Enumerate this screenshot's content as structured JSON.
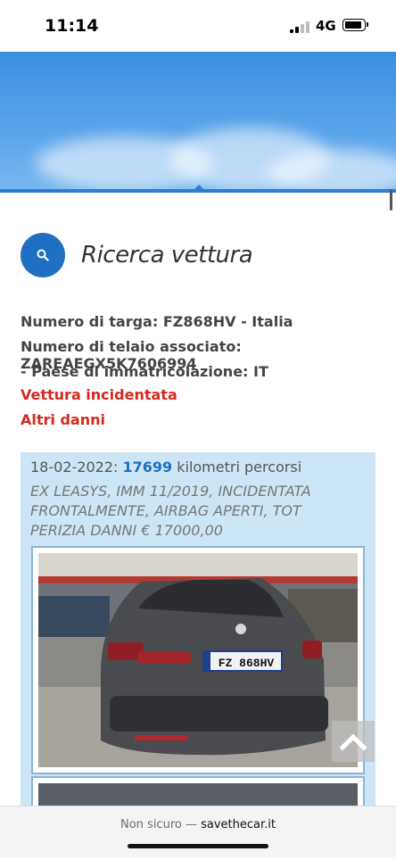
{
  "status_bar": {
    "time": "11:14",
    "network": "4G"
  },
  "section": {
    "title": "Ricerca vettura",
    "icon": "search-icon"
  },
  "vehicle": {
    "plate_line": "Numero di targa: FZ868HV - Italia",
    "chassis_line": "Numero di telaio associato: ZAREAEGX5K7606994",
    "country_line": "- Paese di immatricolazione: IT",
    "alert_1": "Vettura incidentata",
    "alert_2": "Altri danni"
  },
  "record": {
    "date": "18-02-2022",
    "separator": ":",
    "km": "17699",
    "km_label": "kilometri percorsi",
    "description": "EX LEASYS, IMM 11/2019, INCIDENTATA FRONTALMENTE, AIRBAG APERTI, TOT PERIZIA DANNI € 17000,00",
    "photo_plate": "FZ 868HV"
  },
  "browser": {
    "not_secure": "Non sicuro —",
    "domain": "savethecar.it"
  },
  "colors": {
    "accent": "#1f6fc2",
    "alert": "#d42a20",
    "record_bg": "#cde6f5"
  }
}
